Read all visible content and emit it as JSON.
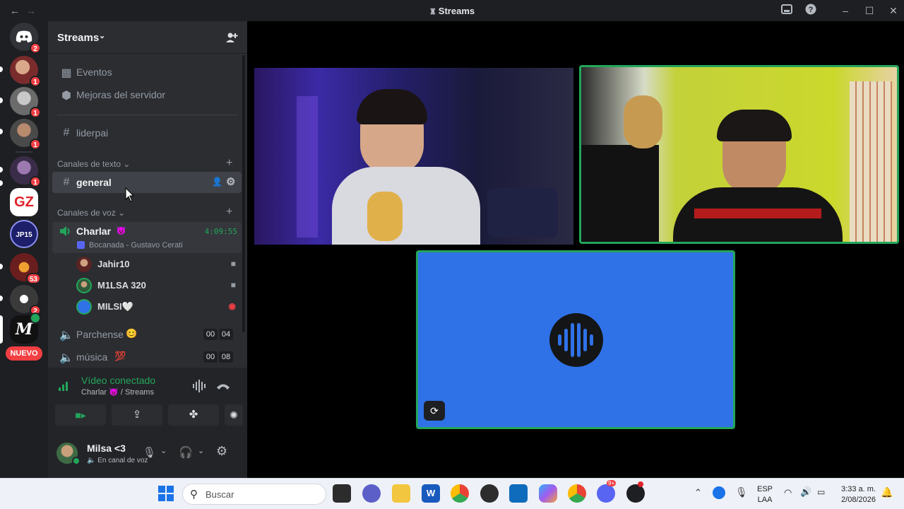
{
  "window": {
    "title": "Streams",
    "back_icon": "arrow-left-icon",
    "forward_icon": "arrow-right-icon"
  },
  "servers": {
    "dm_badge": "2",
    "badges": [
      "1",
      "1",
      "1",
      "1",
      "53",
      "2"
    ],
    "new_label": "NUEVO",
    "gz_label": "GZ",
    "jp_label": "JP15"
  },
  "guild": {
    "name": "Streams"
  },
  "channels": {
    "events": "Eventos",
    "boosts": "Mejoras del servidor",
    "liderpai": "liderpai",
    "text_category": "Canales de texto",
    "general": "general",
    "voice_category": "Canales de voz",
    "charlar": {
      "name": "Charlar",
      "emoji": "👿",
      "timer": "4:09:55",
      "activity": "Bocanada - Gustavo Cerati"
    },
    "users": [
      {
        "name": "Jahir10"
      },
      {
        "name": "M1LSA 320"
      },
      {
        "name": "MILSI🤍"
      }
    ],
    "parchense": {
      "name": "Parchense",
      "emoji": "😊",
      "count_a": "00",
      "count_b": "04"
    },
    "musica": {
      "name": "música",
      "emoji": "💯",
      "count_a": "00",
      "count_b": "08"
    }
  },
  "voice_panel": {
    "status": "Vídeo conectado",
    "channel": "Charlar",
    "channel_emoji": "👿",
    "server": "/ Streams"
  },
  "user": {
    "name": "Milsa <3",
    "status": "En canal de voz"
  },
  "taskbar": {
    "search_placeholder": "Buscar",
    "lang_top": "ESP",
    "lang_bottom": "LAA",
    "time": "3:33 a. m.",
    "date": "2/08/2026",
    "discord_badge": "9+"
  },
  "colors": {
    "accent": "#23a55a",
    "speaking_border": "#23a55a",
    "brand": "#5865f2",
    "tile_blue": "#2f72e8"
  }
}
